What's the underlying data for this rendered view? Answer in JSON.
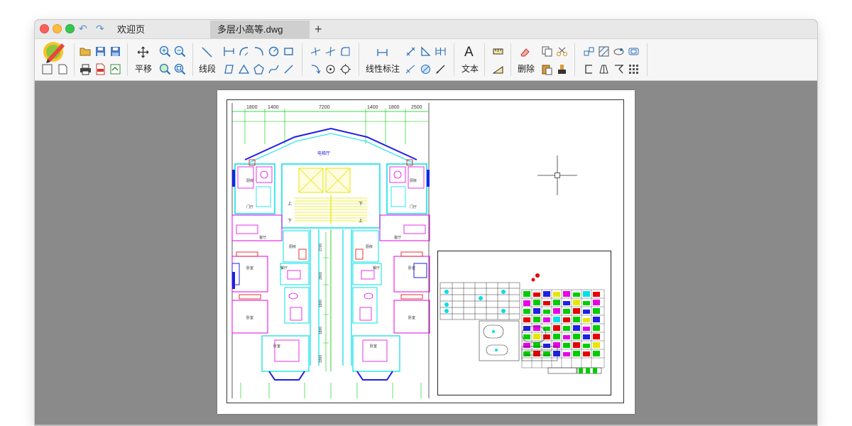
{
  "window": {
    "tabs": [
      {
        "label": "欢迎页"
      },
      {
        "label": "多层小高等.dwg"
      }
    ],
    "add_tab_label": "+"
  },
  "toolbar": {
    "pan_label": "平移",
    "line_label": "线段",
    "dimension_label": "线性标注",
    "text_label": "文本",
    "delete_label": "删除",
    "text_glyph": "A"
  },
  "drawing": {
    "top_dims": [
      "1800",
      "1400",
      "7200",
      "1400",
      "1800",
      "2500"
    ],
    "room_labels": {
      "hall": "电梯厅",
      "kitchen_l": "厨房",
      "kitchen_r": "厨房",
      "bath_l": "门厅",
      "bath_r": "门厅",
      "living_l": "客厅",
      "living_r": "客厅",
      "kitchen_c_l": "厨房",
      "kitchen_c_r": "厨房",
      "dining_l": "餐厅",
      "dining_r": "餐厅",
      "bed1_l": "卧室",
      "bed1_r": "卧室",
      "bed2_l": "卧室",
      "bed2_r": "卧室",
      "master_l": "卧室",
      "master_r": "卧室",
      "up_l": "上",
      "up_r": "下",
      "down_l": "下",
      "down_r": "上"
    },
    "side_dims": [
      "2700",
      "2600",
      "1800",
      "1800",
      "3300"
    ]
  },
  "colors": {
    "accent": "#5b8dcc",
    "canvas_bg": "#8a8a8a",
    "cyan": "#00e0e6",
    "magenta": "#e600e6",
    "green": "#00cc00",
    "yellow": "#e6e600",
    "blue": "#1f1fe6",
    "red": "#e60000"
  }
}
